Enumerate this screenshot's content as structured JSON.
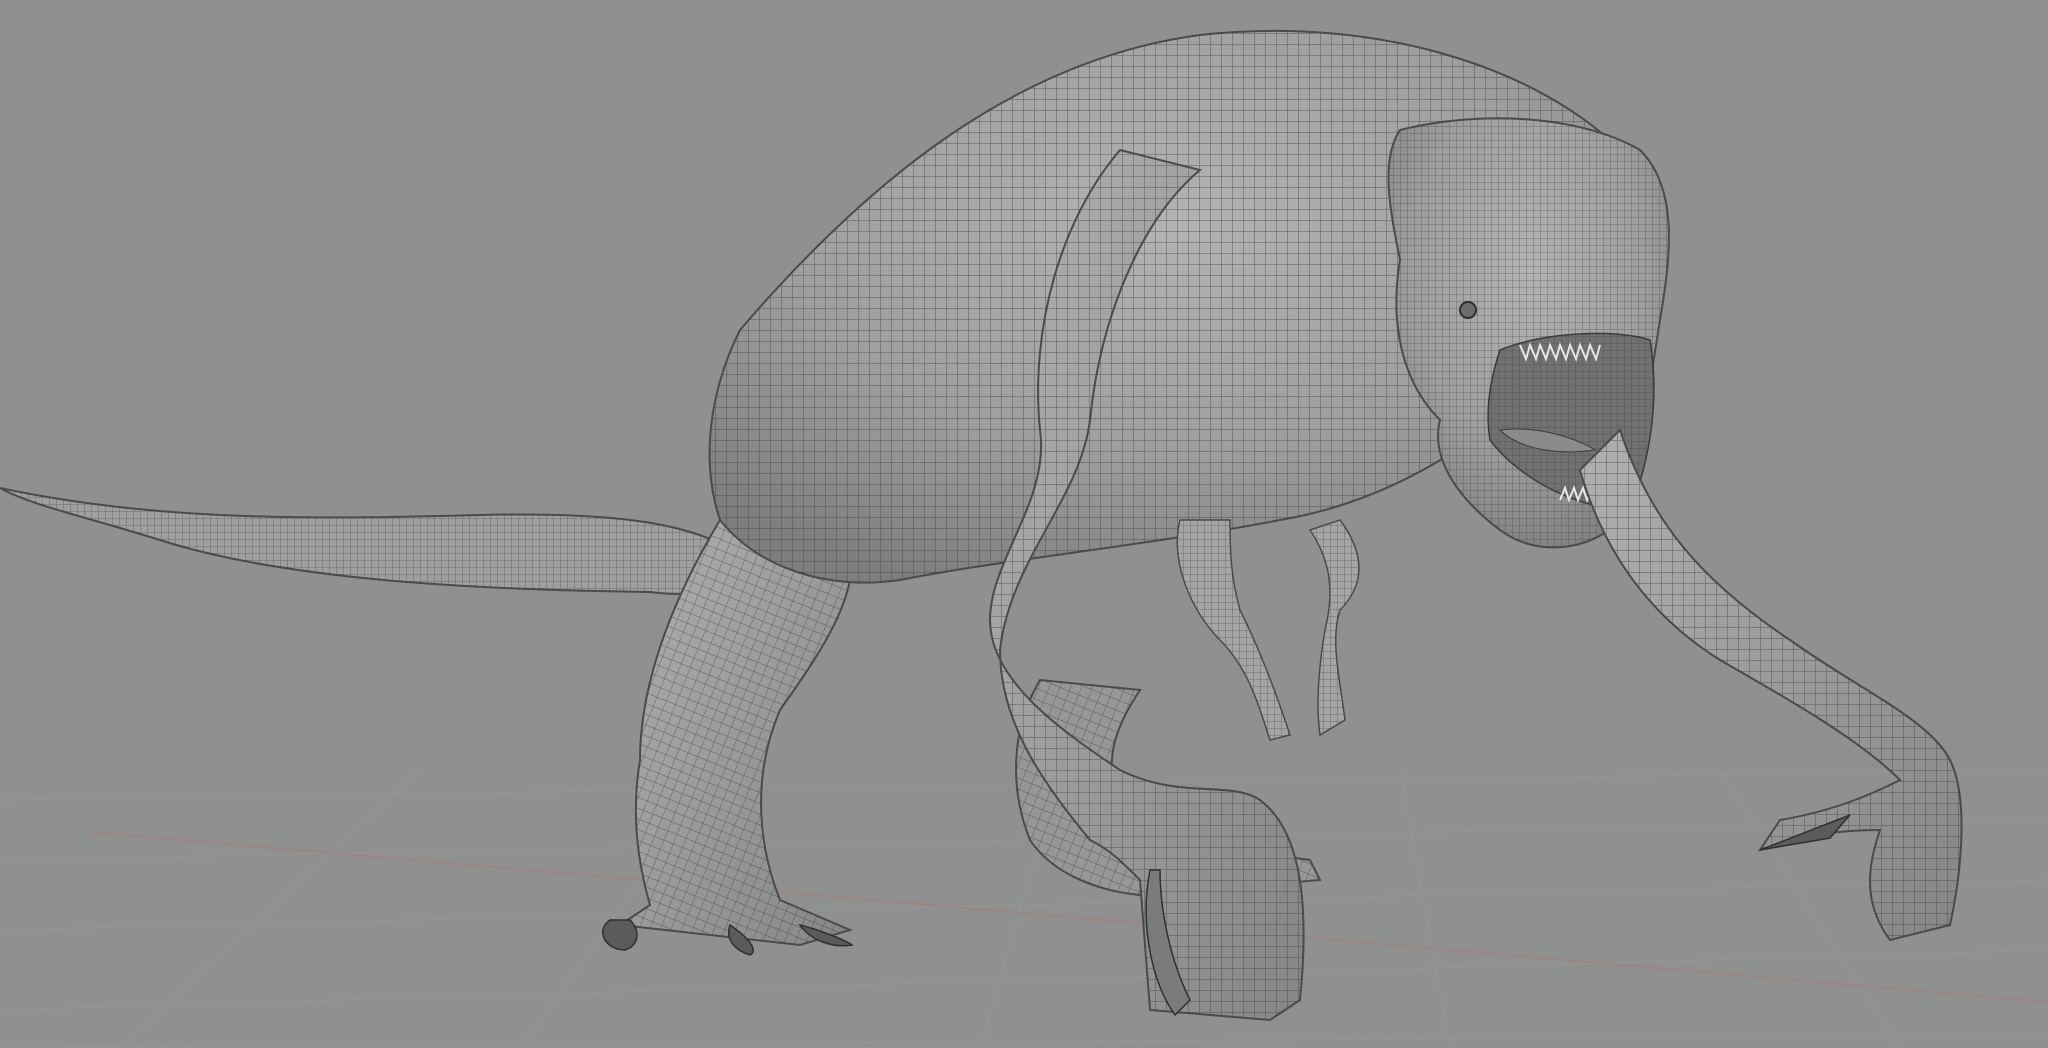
{
  "viewport": {
    "background_color": "#8f9090",
    "grid_color": "#979898",
    "x_axis_color": "#a87d80",
    "model_fill": "#a2a2a2",
    "model_shadow": "#6f7070",
    "wire_color": "#3f4040",
    "object": "creature-wireframe-model"
  }
}
